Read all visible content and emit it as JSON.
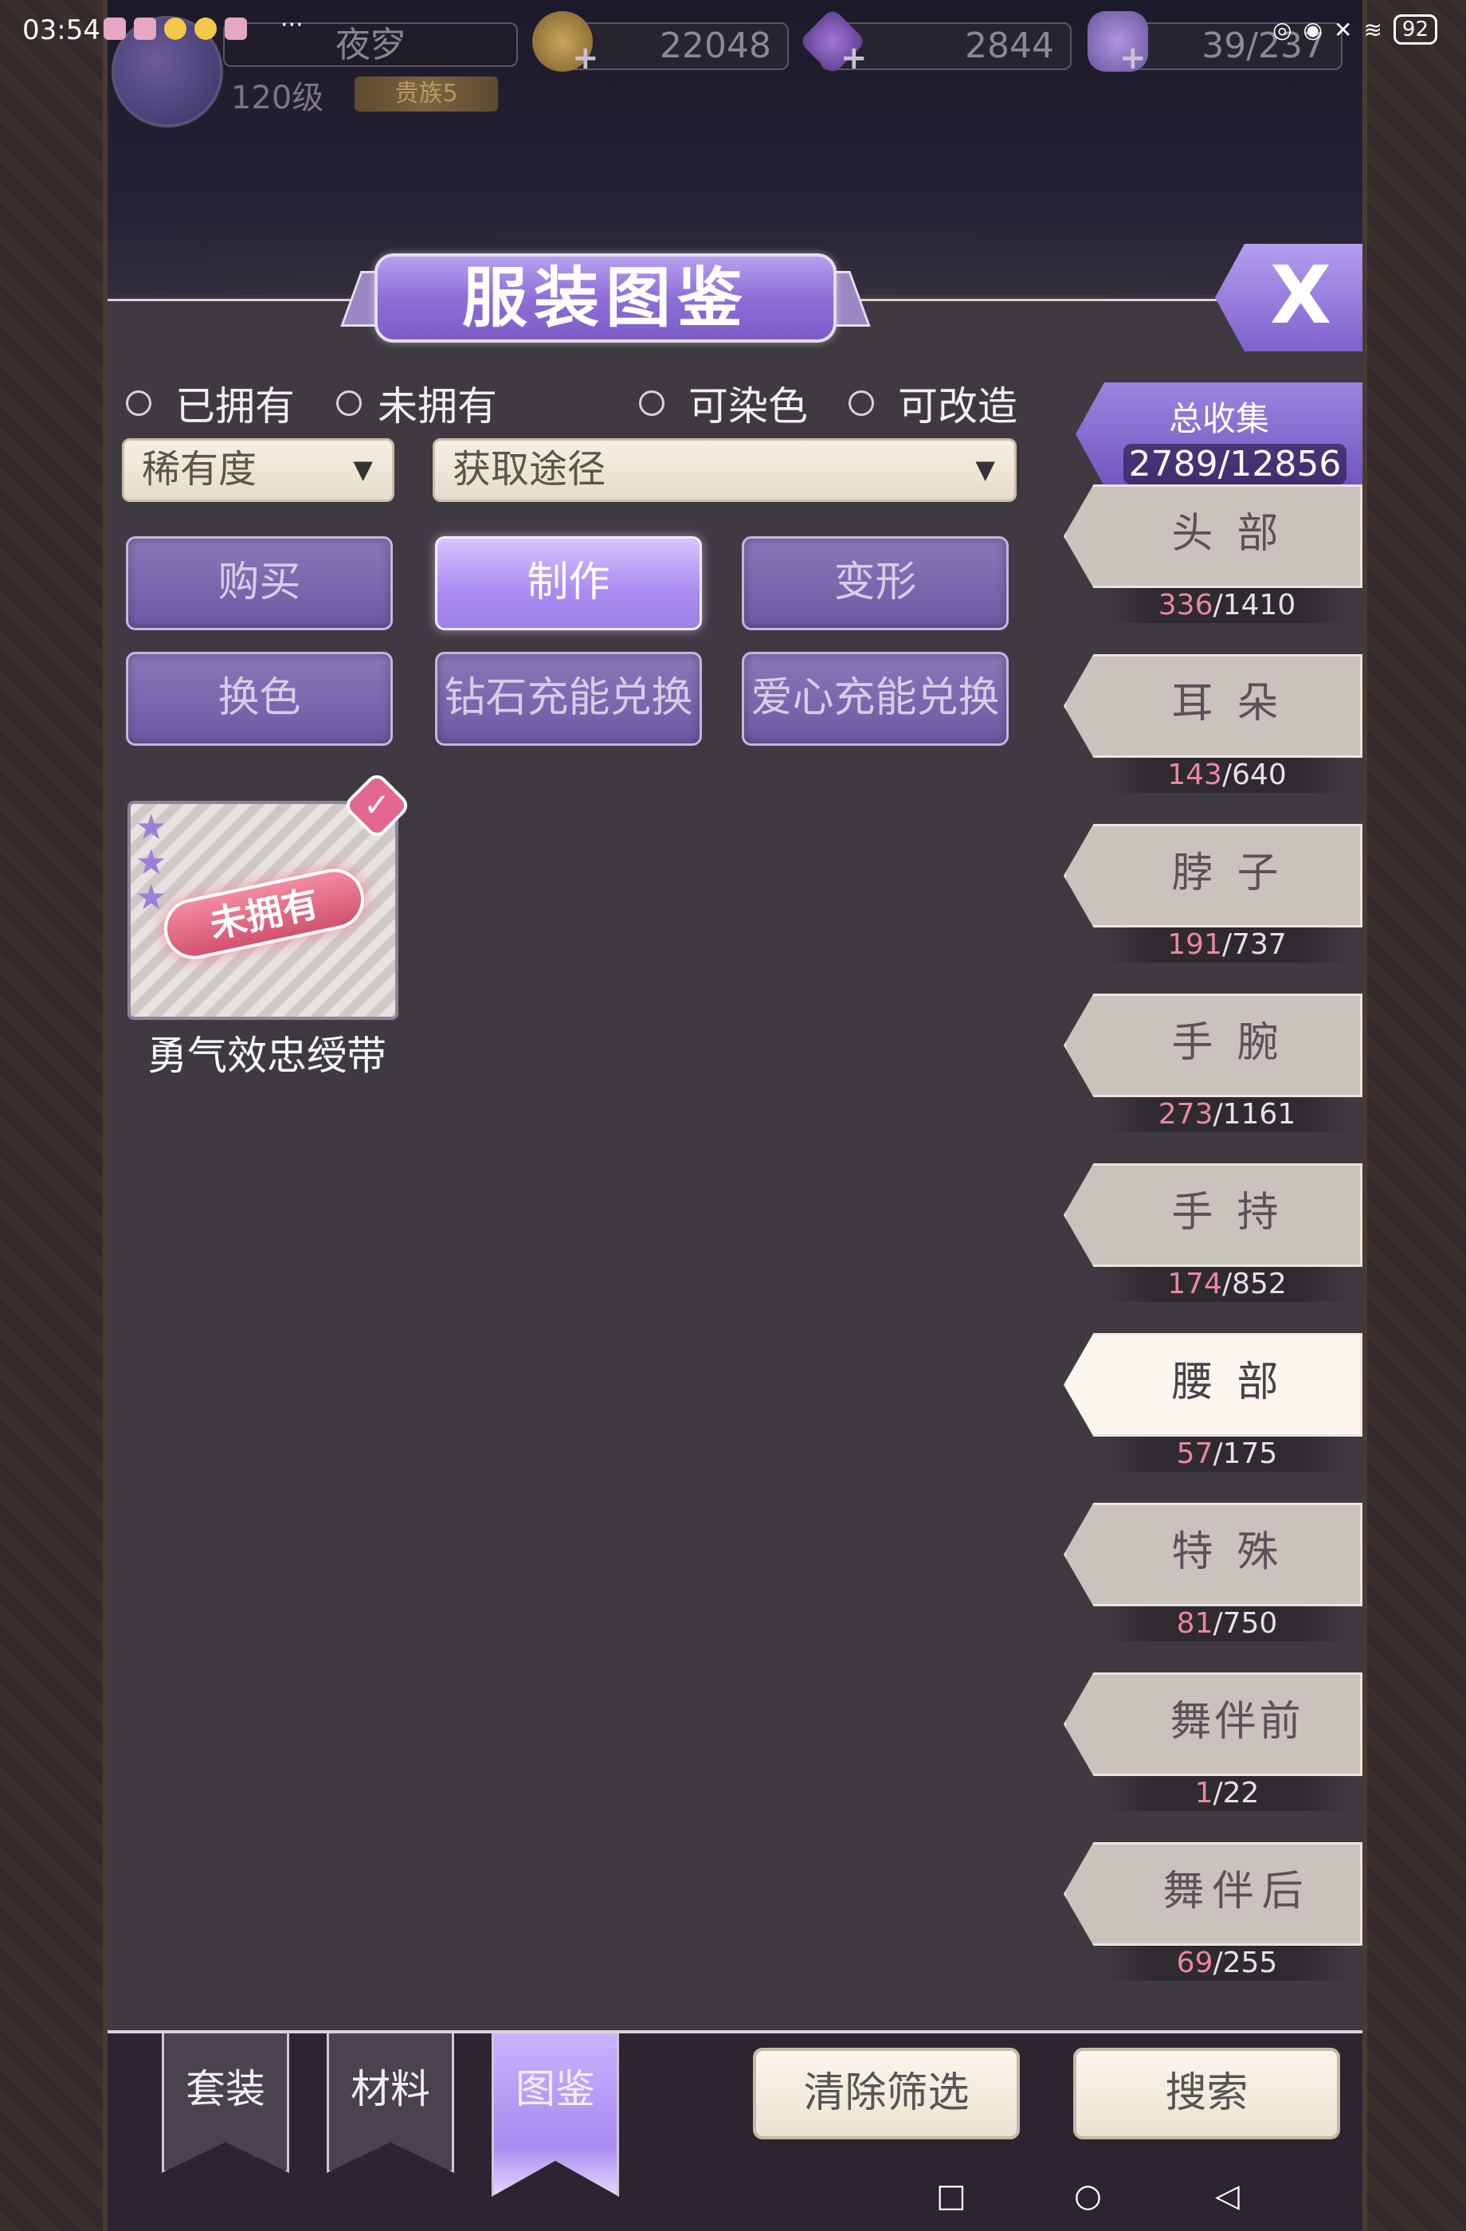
{
  "status_bar": {
    "time": "03:54",
    "more": "···",
    "battery": "92"
  },
  "player": {
    "name": "夜穸",
    "level": "120级",
    "rank": "贵族5"
  },
  "currencies": {
    "gold": "22048",
    "gems": "2844",
    "stamina": "39/237"
  },
  "panel": {
    "title": "服装图鉴",
    "close_label": "X"
  },
  "filters": {
    "owned": "已拥有",
    "not_owned": "未拥有",
    "dyeable": "可染色",
    "modifiable": "可改造",
    "rarity_dropdown": "稀有度",
    "source_dropdown": "获取途径"
  },
  "source_buttons": [
    "购买",
    "制作",
    "变形",
    "换色",
    "钻石充能兑换",
    "爱心充能兑换"
  ],
  "items": [
    {
      "name": "勇气效忠绶带",
      "stamp": "未拥有",
      "stars": 3
    }
  ],
  "collection": {
    "label": "总收集",
    "value": "2789/12856"
  },
  "categories": [
    {
      "label": "头部",
      "owned": "336",
      "total": "/1410"
    },
    {
      "label": "耳朵",
      "owned": "143",
      "total": "/640"
    },
    {
      "label": "脖子",
      "owned": "191",
      "total": "/737"
    },
    {
      "label": "手腕",
      "owned": "273",
      "total": "/1161"
    },
    {
      "label": "手持",
      "owned": "174",
      "total": "/852"
    },
    {
      "label": "腰部",
      "owned": "57",
      "total": "/175"
    },
    {
      "label": "特殊",
      "owned": "81",
      "total": "/750"
    },
    {
      "label": "舞伴前",
      "owned": "1",
      "total": "/22"
    },
    {
      "label": "舞伴后",
      "owned": "69",
      "total": "/255"
    }
  ],
  "bottom_tabs": [
    "套装",
    "材料",
    "图鉴"
  ],
  "bottom_buttons": {
    "clear": "清除筛选",
    "search": "搜索"
  },
  "colors": {
    "accent_purple": "#9a80e6",
    "owned_count_pink": "#e987a3",
    "panel_bg": "#3f3a42"
  }
}
